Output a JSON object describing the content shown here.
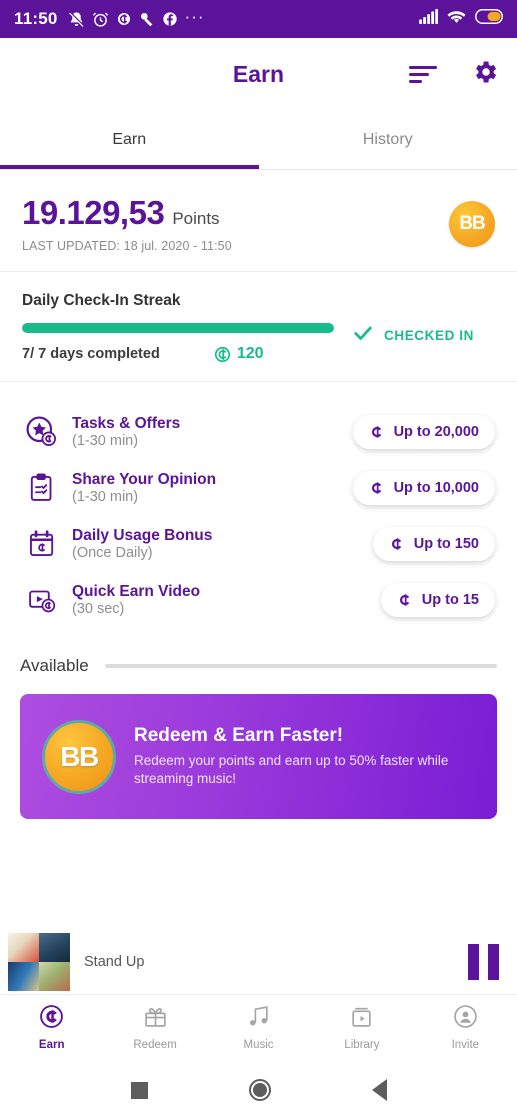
{
  "statusbar": {
    "time": "11:50",
    "icons_left": [
      "bell-muted-icon",
      "alarm-icon",
      "coin-icon",
      "key-icon",
      "facebook-icon"
    ],
    "overflow": "···",
    "icons_right": [
      "signal-icon",
      "wifi-icon",
      "battery-icon"
    ]
  },
  "appbar": {
    "title": "Earn",
    "sort_label": "sort-icon",
    "settings_label": "gear-icon"
  },
  "tabs": [
    {
      "label": "Earn",
      "active": true
    },
    {
      "label": "History",
      "active": false
    }
  ],
  "points": {
    "value": "19.129,53",
    "unit": "Points",
    "last_updated": "LAST UPDATED: 18 jul. 2020 - 11:50",
    "avatar_initials": "BB"
  },
  "checkin": {
    "title": "Daily Check-In Streak",
    "progress_percent": 100,
    "days_text": "7/ 7 days completed",
    "coin_value": "120",
    "status": "CHECKED IN"
  },
  "earn_items": [
    {
      "icon": "star-badge-icon",
      "name": "Tasks & Offers",
      "meta": "(1-30 min)",
      "reward": "Up to 20,000"
    },
    {
      "icon": "clipboard-icon",
      "name": "Share Your Opinion",
      "meta": "(1-30 min)",
      "reward": "Up to 10,000"
    },
    {
      "icon": "calendar-coin-icon",
      "name": "Daily Usage Bonus",
      "meta": "(Once Daily)",
      "reward": "Up to 150"
    },
    {
      "icon": "video-coin-icon",
      "name": "Quick Earn Video",
      "meta": "(30 sec)",
      "reward": "Up to 15"
    }
  ],
  "available": {
    "label": "Available"
  },
  "banner": {
    "logo_initials": "BB",
    "title": "Redeem & Earn Faster!",
    "subtitle": "Redeem your points and earn up to 50% faster while streaming music!"
  },
  "miniplayer": {
    "track_title": "Stand Up",
    "control": "pause-button"
  },
  "bottomnav": [
    {
      "label": "Earn",
      "icon": "coin-circle-icon",
      "active": true
    },
    {
      "label": "Redeem",
      "icon": "gift-icon",
      "active": false
    },
    {
      "label": "Music",
      "icon": "music-note-icon",
      "active": false
    },
    {
      "label": "Library",
      "icon": "library-icon",
      "active": false
    },
    {
      "label": "Invite",
      "icon": "person-circle-icon",
      "active": false
    }
  ],
  "sysnav": [
    "recents-square-icon",
    "home-circle-icon",
    "back-triangle-icon"
  ],
  "colors": {
    "brand_purple": "#5B1499",
    "green": "#18BC8C",
    "gold": "#F5A623",
    "banner_from": "#AE4DE0",
    "banner_to": "#7A1DD4"
  }
}
